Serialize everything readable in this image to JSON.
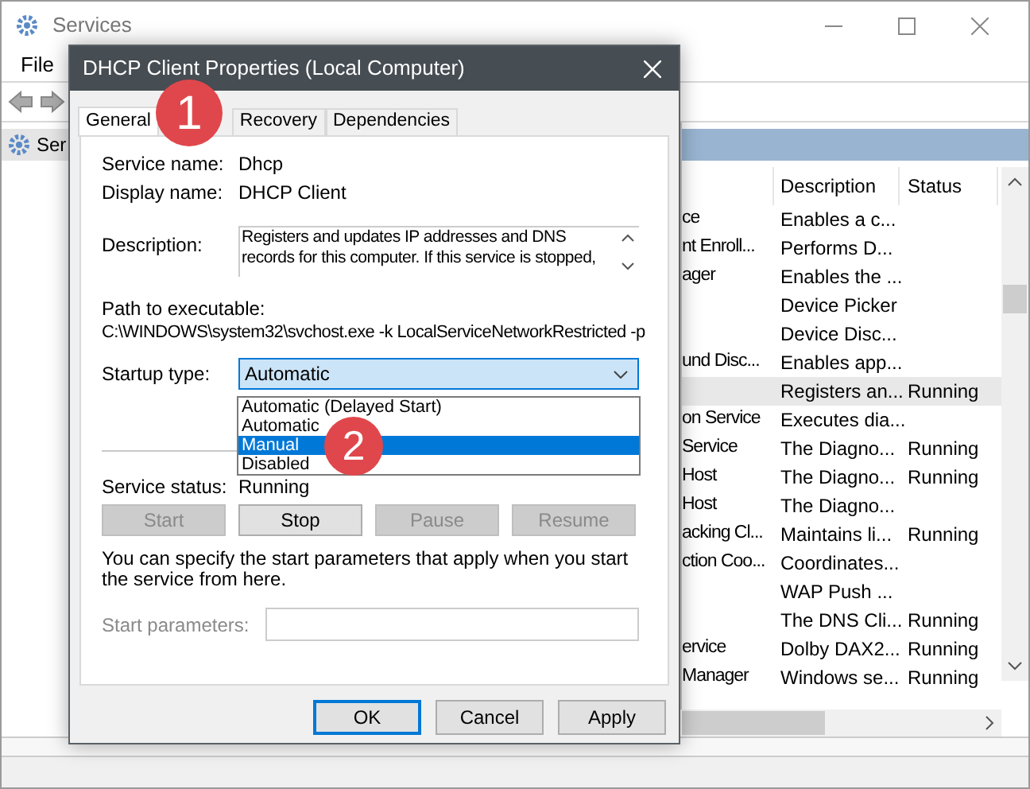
{
  "window": {
    "title": "Services"
  },
  "menu": [
    "File"
  ],
  "tree": {
    "item": "Ser"
  },
  "list": {
    "columns": [
      "Description",
      "Status"
    ],
    "rows": [
      {
        "name": "ce",
        "description": "Enables a c...",
        "status": "",
        "selected": false
      },
      {
        "name": "nt Enroll...",
        "description": "Performs D...",
        "status": "",
        "selected": false
      },
      {
        "name": "ager",
        "description": "Enables the ...",
        "status": "",
        "selected": false
      },
      {
        "name": "",
        "description": "Device Picker",
        "status": "",
        "selected": false
      },
      {
        "name": "",
        "description": "Device Disc...",
        "status": "",
        "selected": false
      },
      {
        "name": "und Disc...",
        "description": "Enables app...",
        "status": "",
        "selected": false
      },
      {
        "name": "",
        "description": "Registers an...",
        "status": "Running",
        "selected": true
      },
      {
        "name": "on Service",
        "description": "Executes dia...",
        "status": "",
        "selected": false
      },
      {
        "name": "Service",
        "description": "The Diagno...",
        "status": "Running",
        "selected": false
      },
      {
        "name": "Host",
        "description": "The Diagno...",
        "status": "Running",
        "selected": false
      },
      {
        "name": "Host",
        "description": "The Diagno...",
        "status": "",
        "selected": false
      },
      {
        "name": "acking Cl...",
        "description": "Maintains li...",
        "status": "Running",
        "selected": false
      },
      {
        "name": "ction Coo...",
        "description": "Coordinates...",
        "status": "",
        "selected": false
      },
      {
        "name": "",
        "description": "WAP Push ...",
        "status": "",
        "selected": false
      },
      {
        "name": "",
        "description": "The DNS Cli...",
        "status": "Running",
        "selected": false
      },
      {
        "name": "ervice",
        "description": "Dolby DAX2...",
        "status": "Running",
        "selected": false
      },
      {
        "name": "Manager",
        "description": "Windows se...",
        "status": "Running",
        "selected": false
      }
    ]
  },
  "dialog": {
    "title": "DHCP Client Properties (Local Computer)",
    "tabs": [
      {
        "label": "General",
        "selected": true
      },
      {
        "label": "Recovery",
        "selected": false
      },
      {
        "label": "Dependencies",
        "selected": false
      }
    ],
    "service_name": {
      "label": "Service name:",
      "value": "Dhcp"
    },
    "display_name": {
      "label": "Display name:",
      "value": "DHCP Client"
    },
    "description": {
      "label": "Description:",
      "value": "Registers and updates IP addresses and DNS records for this computer. If this service is stopped,"
    },
    "path": {
      "label": "Path to executable:",
      "value": "C:\\WINDOWS\\system32\\svchost.exe -k LocalServiceNetworkRestricted -p"
    },
    "startup_type": {
      "label": "Startup type:",
      "value": "Automatic",
      "options": [
        {
          "label": "Automatic (Delayed Start)",
          "highlighted": false
        },
        {
          "label": "Automatic",
          "highlighted": false
        },
        {
          "label": "Manual",
          "highlighted": true
        },
        {
          "label": "Disabled",
          "highlighted": false
        }
      ]
    },
    "service_status": {
      "label": "Service status:",
      "value": "Running"
    },
    "control_buttons": [
      {
        "label": "Start",
        "disabled": true
      },
      {
        "label": "Stop",
        "disabled": false
      },
      {
        "label": "Pause",
        "disabled": true
      },
      {
        "label": "Resume",
        "disabled": true
      }
    ],
    "hint": "You can specify the start parameters that apply when you start the service from here.",
    "start_parameters": {
      "label": "Start parameters:",
      "disabled": true
    },
    "buttons": [
      {
        "label": "OK",
        "default": true
      },
      {
        "label": "Cancel",
        "default": false
      },
      {
        "label": "Apply",
        "default": false
      }
    ]
  },
  "annotations": [
    {
      "label": "1"
    },
    {
      "label": "2"
    }
  ]
}
